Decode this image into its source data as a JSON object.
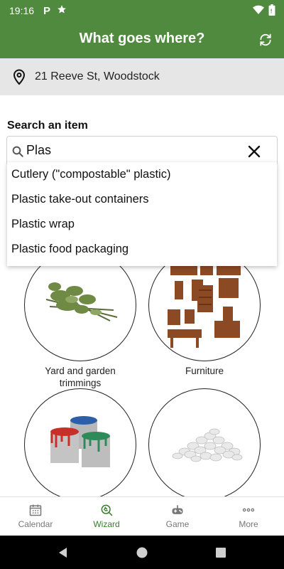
{
  "status_bar": {
    "time": "19:16"
  },
  "header": {
    "title": "What goes where?"
  },
  "address": {
    "text": "21 Reeve St, Woodstock"
  },
  "search": {
    "label": "Search an item",
    "value": "Plas",
    "suggestions": [
      "Cutlery (\"compostable\" plastic)",
      "Plastic take-out containers",
      "Plastic wrap",
      "Plastic food packaging"
    ]
  },
  "categories": [
    {
      "label": "Yard and garden trimmings"
    },
    {
      "label": "Furniture"
    },
    {
      "label": ""
    },
    {
      "label": ""
    }
  ],
  "bottom_nav": {
    "items": [
      {
        "label": "Calendar"
      },
      {
        "label": "Wizard"
      },
      {
        "label": "Game"
      },
      {
        "label": "More"
      }
    ]
  },
  "colors": {
    "brand_green": "#4f8a3e",
    "active_green": "#3a7d2c"
  }
}
